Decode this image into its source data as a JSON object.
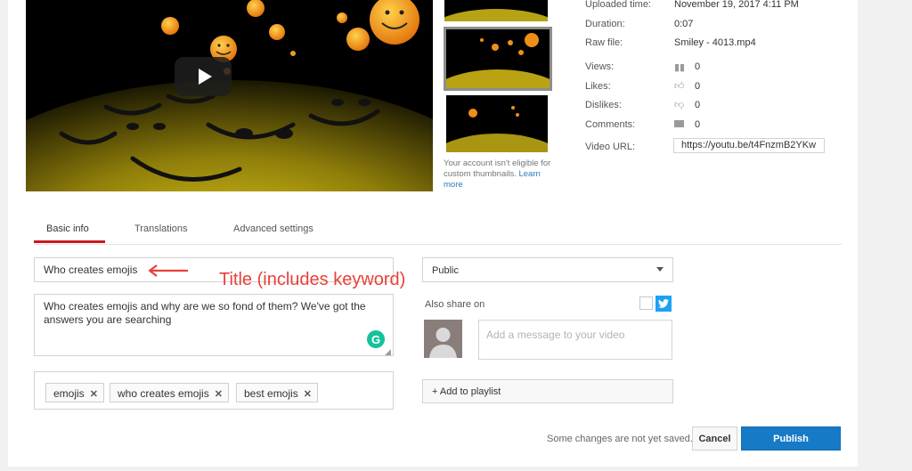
{
  "video": {
    "play_icon": "play-icon"
  },
  "thumbnails": {
    "note_text": "Your account isn't eligible for custom thumbnails.",
    "learn_more": "Learn more"
  },
  "metadata": {
    "uploaded_label": "Uploaded time:",
    "uploaded_value": "November 19, 2017 4:11 PM",
    "duration_label": "Duration:",
    "duration_value": "0:07",
    "raw_label": "Raw file:",
    "raw_value": "Smiley - 4013.mp4",
    "views_label": "Views:",
    "views_value": "0",
    "likes_label": "Likes:",
    "likes_value": "0",
    "dislikes_label": "Dislikes:",
    "dislikes_value": "0",
    "comments_label": "Comments:",
    "comments_value": "0",
    "url_label": "Video URL:",
    "url_value": "https://youtu.be/t4FnzmB2YKw"
  },
  "tabs": [
    {
      "label": "Basic info",
      "active": true
    },
    {
      "label": "Translations",
      "active": false
    },
    {
      "label": "Advanced settings",
      "active": false
    }
  ],
  "form": {
    "title_value": "Who creates emojis",
    "description_value": "Who creates emojis and why are we so fond of them? We've got the answers you are searching",
    "tags": [
      {
        "label": "emojis"
      },
      {
        "label": "who creates emojis"
      },
      {
        "label": "best emojis"
      }
    ]
  },
  "annotation": {
    "text": "Title (includes keyword)",
    "color": "#e8413a"
  },
  "sharing": {
    "privacy_value": "Public",
    "also_share_label": "Also share on",
    "message_placeholder": "Add a message to your video",
    "playlist_label": "+ Add to playlist"
  },
  "footer": {
    "status_text": "Some changes are not yet saved.",
    "cancel_label": "Cancel",
    "publish_label": "Publish"
  },
  "colors": {
    "accent": "#167ac6",
    "tab_active": "#cc181e",
    "twitter": "#1da1f2",
    "grammarly": "#15c39a"
  }
}
